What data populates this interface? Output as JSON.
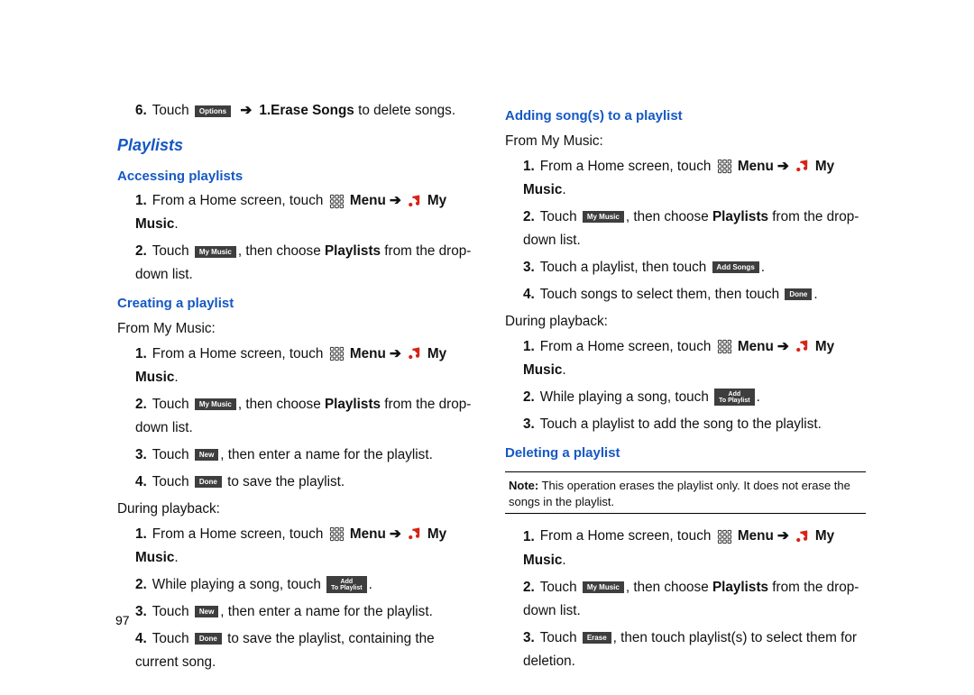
{
  "pageNumber": "97",
  "section": {
    "title": "Playlists"
  },
  "headings": {
    "accessing": "Accessing playlists",
    "creating": "Creating a playlist",
    "adding": "Adding song(s) to a playlist",
    "deleting": "Deleting a playlist"
  },
  "labels": {
    "fromMyMusic": "From My Music:",
    "duringPlayback": "During playback:"
  },
  "buttons": {
    "options": "Options",
    "myMusic": "My Music",
    "new": "New",
    "done": "Done",
    "addToPlaylist1": "Add",
    "addToPlaylist2": "To Playlist",
    "addSongs": "Add Songs",
    "erase": "Erase"
  },
  "text": {
    "step6a": "Touch ",
    "step6b": " 1.Erase Songs",
    "step6c": " to delete songs.",
    "fromHome": "From a Home screen, touch ",
    "menuLabel": "Menu",
    "myMusicBold": "My Music",
    "touch": "Touch ",
    "playlistsFromDropdown": ", then choose ",
    "playlists": "Playlists",
    "fromDropDownList": " from the drop-down list.",
    "enterName": ", then enter a name for the playlist.",
    "toSave": " to save the playlist.",
    "toSaveCurrent": " to save the playlist, containing the current song.",
    "whilePlaying": "While playing a song, touch ",
    "touchPlaylistThen": "Touch a playlist, then touch ",
    "touchSongsSelect": "Touch songs to select them, then touch ",
    "touchPlaylistAdd": "Touch a playlist to add the song to the playlist.",
    "noteLabel": "Note:",
    "noteBody": " This operation erases the playlist only. It does not erase the songs in the playlist.",
    "thenTouchSelect": ", then touch playlist(s) to select them for deletion.",
    "dot": "."
  }
}
